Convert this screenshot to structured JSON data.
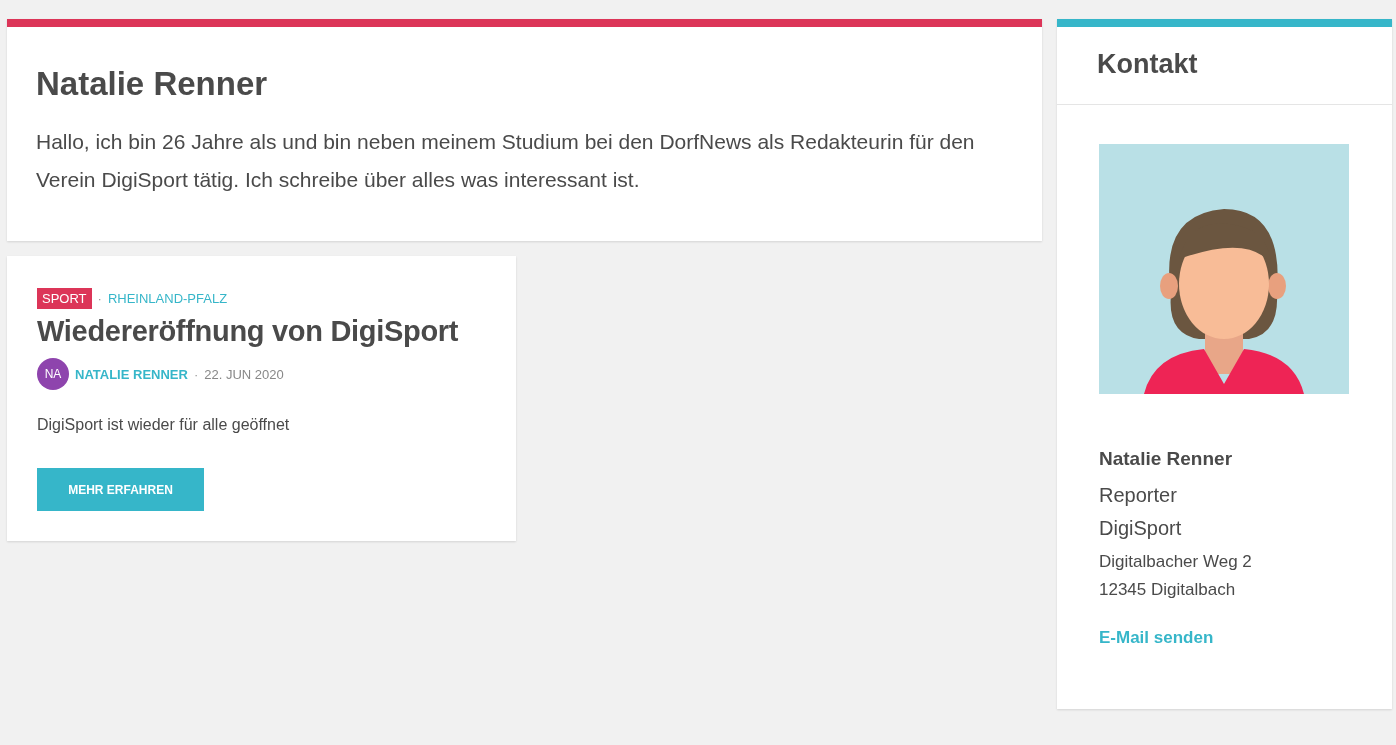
{
  "profile": {
    "name": "Natalie Renner",
    "bio": "Hallo, ich bin 26 Jahre als und bin neben meinem Studium bei den DorfNews als Redakteurin für den Verein DigiSport tätig. Ich schreibe über alles was interessant ist."
  },
  "posts": [
    {
      "category": "SPORT",
      "separator": "·",
      "region": "RHEINLAND-PFALZ",
      "title": "Wiedereröffnung von DigiSport",
      "avatar": "NA",
      "author": "NATALIE RENNER",
      "date_separator": "·",
      "date": "22. JUN 2020",
      "excerpt": "DigiSport ist wieder für alle geöffnet",
      "button": "MEHR ERFAHREN"
    }
  ],
  "contact": {
    "heading": "Kontakt",
    "name": "Natalie Renner",
    "role": "Reporter",
    "organization": "DigiSport",
    "address": [
      "Digitalbacher Weg 2",
      "12345 Digitalbach"
    ],
    "link": "E-Mail senden"
  }
}
